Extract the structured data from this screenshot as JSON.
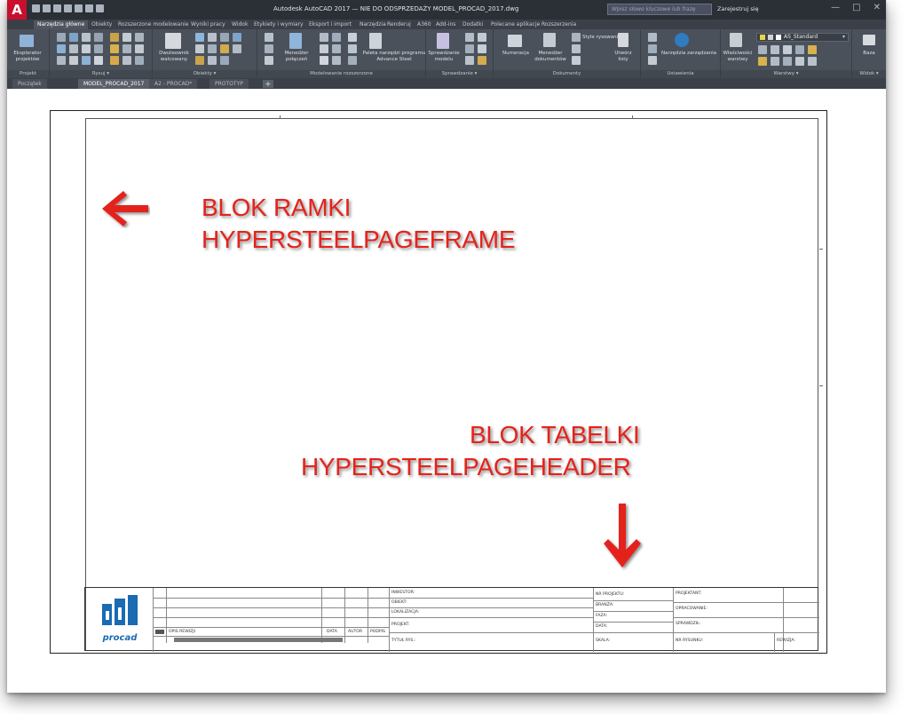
{
  "app": {
    "logo_letter": "A",
    "title": "Autodesk AutoCAD 2017 — NIE DO ODSPRZEDAŻY   MODEL_PROCAD_2017.dwg",
    "search_placeholder": "Wpisz słowo kluczowe lub frazę",
    "signin": "Zarejestruj się",
    "window_controls": [
      "—",
      "□",
      "✕"
    ]
  },
  "ribbon_tabs": [
    "Narzędzia główne",
    "Obiekty",
    "Rozszerzone modelowanie",
    "Wyniki pracy",
    "Widok",
    "Etykiety i wymiary",
    "Eksport i import",
    "Narzędzia",
    "Renderuj",
    "A360",
    "Add-ins",
    "Dodatki",
    "Polecane aplikacje",
    "Rozszerzenia"
  ],
  "ribbon": {
    "groups": [
      {
        "label": "Projekt"
      },
      {
        "label": "Rysuj ▾"
      },
      {
        "label": "Obiekty ▾"
      },
      {
        "label": "Modelowanie rozszerzone"
      },
      {
        "label": "Sprawdzanie ▾"
      },
      {
        "label": "Dokumenty"
      },
      {
        "label": "Ustawienia"
      },
      {
        "label": "Warstwy ▾"
      },
      {
        "label": "Widok ▾"
      }
    ],
    "buttons": {
      "eksplorator": "Eksplorator projektów",
      "dwuteownik": "Dwuteownik walcowany",
      "menedzer_polaczen": "Menedżer połączeń",
      "paleta": "Paleta narzędzi programu Advance Steel",
      "sprawdzanie": "Sprawdzanie modelu",
      "numeracja": "Numeracja",
      "menedzer_dokumentow": "Menedżer dokumentów",
      "style_rysowania": "Style rysowania",
      "utworz_listy": "Utwórz listy",
      "narzedzia_zarzadzania": "Narzędzia zarządzania",
      "wlasciwosci_warstwy": "Właściwości warstwy",
      "layer_name": "AS_Standard",
      "baza": "Baza"
    }
  },
  "doc_tabs": [
    "Początek",
    "MODEL_PROCAD_2017",
    "A2 - PROCAD*",
    "PROTOTYP"
  ],
  "annotations": {
    "frame_line1": "BLOK RAMKI",
    "frame_line2": "HYPERSTEELPAGEFRAME",
    "header_line1": "BLOK TABELKI",
    "header_line2": "HYPERSTEELPAGEHEADER"
  },
  "title_block": {
    "logo_text": "procad",
    "revision_headers": {
      "opis": "OPIS REWIZJI",
      "data": "DATA",
      "autor": "AUTOR",
      "podpis": "PODPIS"
    },
    "col1": [
      "INWESTOR:",
      "OBIEKT:",
      "LOKALIZACJA:",
      "PROJEKT:",
      "TYTUŁ RYS.:"
    ],
    "col2": [
      "NR PROJEKTU:",
      "BRANŻA:",
      "FAZA:",
      "DATA:",
      "SKALA:"
    ],
    "col3": [
      "PROJEKTANT:",
      "OPRACOWANIE:",
      "SPRAWDZIŁ:",
      "NR RYSUNKU:"
    ],
    "rewizja": "REWIZJA:"
  },
  "colors": {
    "annotation_red": "#e4231b",
    "logo_blue": "#1a6bb4",
    "app_red": "#c8102e"
  }
}
